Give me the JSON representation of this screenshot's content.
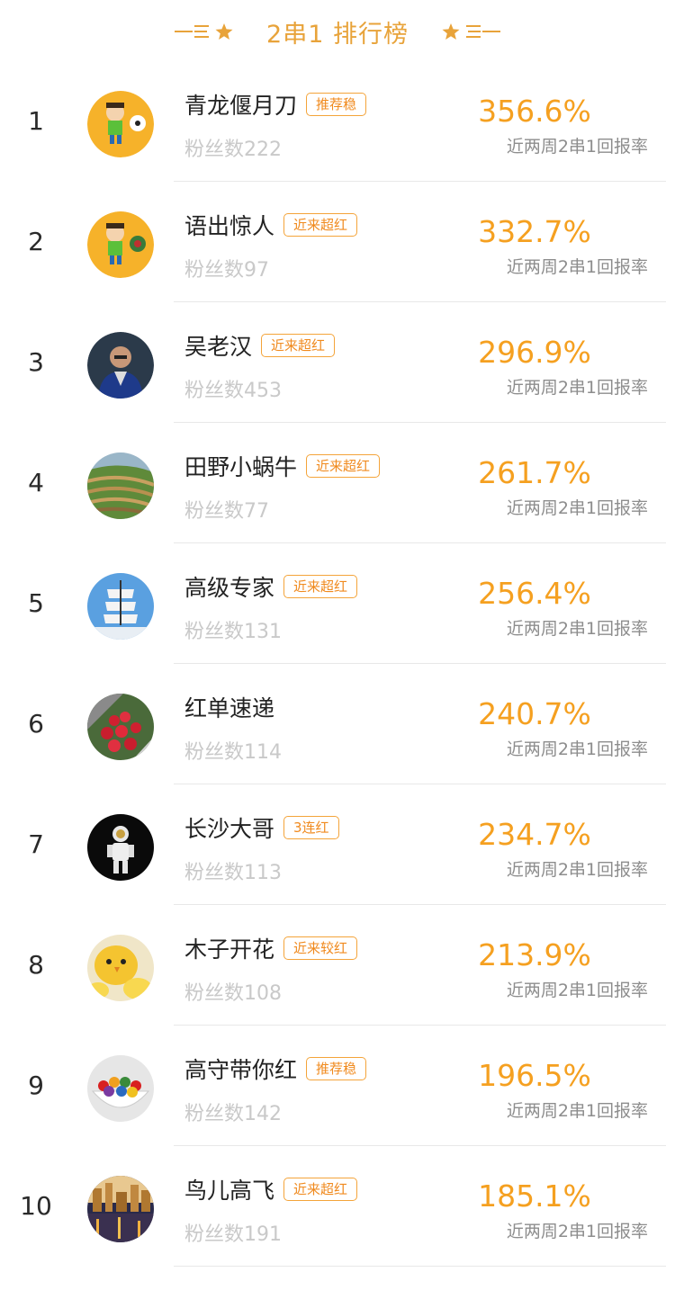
{
  "header": {
    "title": "2串1 排行榜",
    "accent": "#e8a33a"
  },
  "colors": {
    "rate": "#f5a020",
    "tag_border": "#f4a43a",
    "fans": "#c9c9c9"
  },
  "rows": [
    {
      "rank": "1",
      "name": "青龙偃月刀",
      "tag": "推荐稳",
      "fans": "粉丝数222",
      "rate": "356.6%",
      "rate_label": "近两周2串1回报率",
      "avatar": "cartoon-soccer-player-avatar"
    },
    {
      "rank": "2",
      "name": "语出惊人",
      "tag": "近来超红",
      "fans": "粉丝数97",
      "rate": "332.7%",
      "rate_label": "近两周2串1回报率",
      "avatar": "cartoon-soccer-player-avatar"
    },
    {
      "rank": "3",
      "name": "吴老汉",
      "tag": "近来超红",
      "fans": "粉丝数453",
      "rate": "296.9%",
      "rate_label": "近两周2串1回报率",
      "avatar": "person-photo-avatar"
    },
    {
      "rank": "4",
      "name": "田野小蜗牛",
      "tag": "近来超红",
      "fans": "粉丝数77",
      "rate": "261.7%",
      "rate_label": "近两周2串1回报率",
      "avatar": "terraced-fields-avatar"
    },
    {
      "rank": "5",
      "name": "高级专家",
      "tag": "近来超红",
      "fans": "粉丝数131",
      "rate": "256.4%",
      "rate_label": "近两周2串1回报率",
      "avatar": "sailing-ship-avatar"
    },
    {
      "rank": "6",
      "name": "红单速递",
      "tag": "",
      "fans": "粉丝数114",
      "rate": "240.7%",
      "rate_label": "近两周2串1回报率",
      "avatar": "red-flowers-avatar"
    },
    {
      "rank": "7",
      "name": "长沙大哥",
      "tag": "3连红",
      "fans": "粉丝数113",
      "rate": "234.7%",
      "rate_label": "近两周2串1回报率",
      "avatar": "astronaut-avatar"
    },
    {
      "rank": "8",
      "name": "木子开花",
      "tag": "近来较红",
      "fans": "粉丝数108",
      "rate": "213.9%",
      "rate_label": "近两周2串1回报率",
      "avatar": "yellow-chick-avatar"
    },
    {
      "rank": "9",
      "name": "高守带你红",
      "tag": "推荐稳",
      "fans": "粉丝数142",
      "rate": "196.5%",
      "rate_label": "近两周2串1回报率",
      "avatar": "candy-bowl-avatar"
    },
    {
      "rank": "10",
      "name": "鸟儿高飞",
      "tag": "近来超红",
      "fans": "粉丝数191",
      "rate": "185.1%",
      "rate_label": "近两周2串1回报率",
      "avatar": "city-lights-avatar"
    }
  ]
}
